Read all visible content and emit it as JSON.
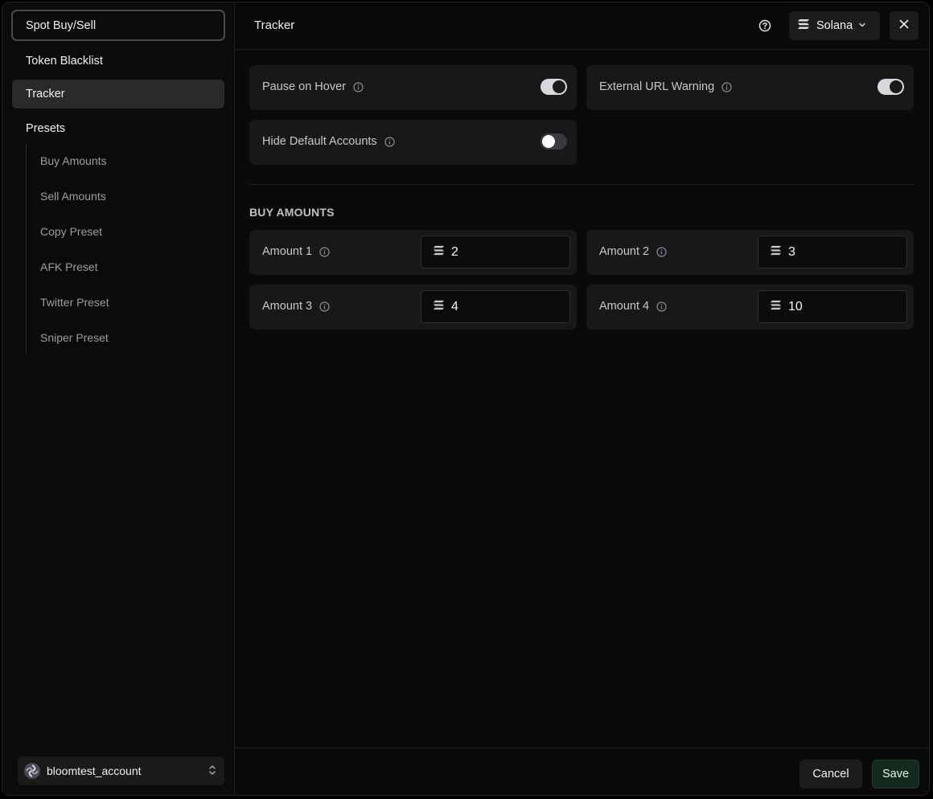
{
  "sidebar": {
    "items": [
      {
        "label": "Spot Buy/Sell"
      },
      {
        "label": "Token Blacklist"
      },
      {
        "label": "Tracker"
      },
      {
        "label": "Presets"
      }
    ],
    "presets": [
      {
        "label": "Buy Amounts"
      },
      {
        "label": "Sell Amounts"
      },
      {
        "label": "Copy Preset"
      },
      {
        "label": "AFK Preset"
      },
      {
        "label": "Twitter Preset"
      },
      {
        "label": "Sniper Preset"
      }
    ],
    "account": {
      "name": "bloomtest_account"
    }
  },
  "header": {
    "title": "Tracker",
    "chain": "Solana"
  },
  "toggles": [
    {
      "label": "Pause on Hover",
      "on": true
    },
    {
      "label": "External URL Warning",
      "on": true
    },
    {
      "label": "Hide Default Accounts",
      "on": false
    }
  ],
  "buy_amounts": {
    "title": "BUY AMOUNTS",
    "items": [
      {
        "label": "Amount 1",
        "value": "2"
      },
      {
        "label": "Amount 2",
        "value": "3"
      },
      {
        "label": "Amount 3",
        "value": "4"
      },
      {
        "label": "Amount 4",
        "value": "10"
      }
    ]
  },
  "footer": {
    "cancel_label": "Cancel",
    "save_label": "Save"
  },
  "icons": {
    "help": "help-circle-icon",
    "chain": "solana-icon",
    "close": "close-icon",
    "info": "info-icon",
    "chevron": "chevron-down-icon",
    "updown": "chevron-updown-icon"
  }
}
